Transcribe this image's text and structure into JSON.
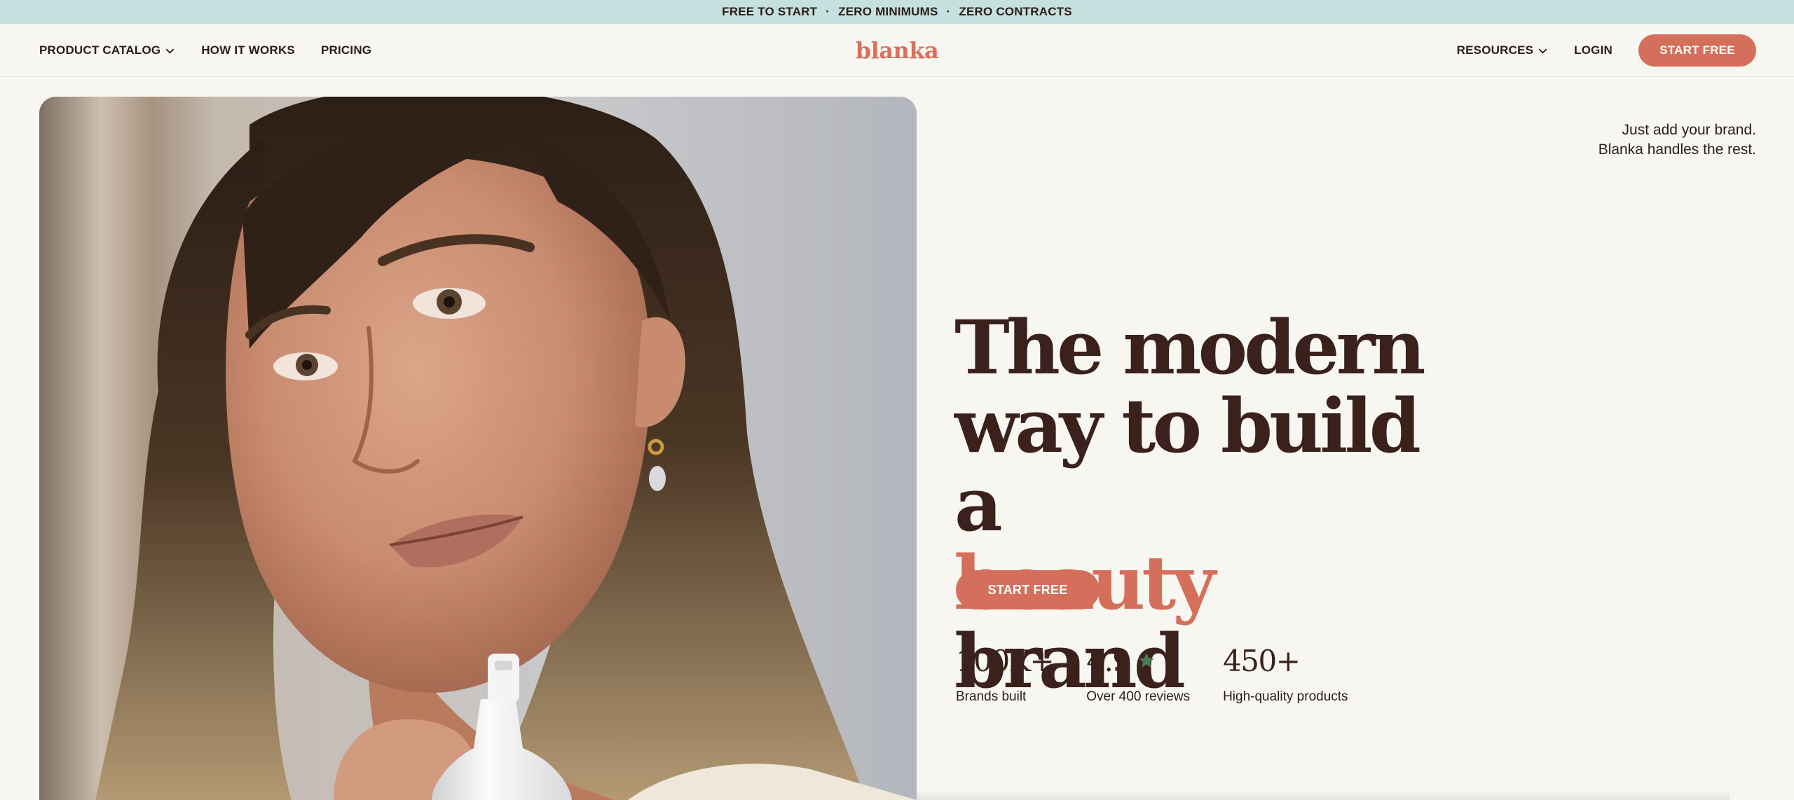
{
  "announcement": {
    "items": [
      "FREE TO START",
      "ZERO MINIMUMS",
      "ZERO CONTRACTS"
    ],
    "separator": "·"
  },
  "nav": {
    "left": [
      {
        "label": "PRODUCT CATALOG",
        "dropdown": true
      },
      {
        "label": "HOW IT WORKS"
      },
      {
        "label": "PRICING"
      }
    ],
    "logo": "blanka",
    "right": {
      "resources": "RESOURCES",
      "login": "LOGIN",
      "cta": "START FREE"
    }
  },
  "hero": {
    "tagline_line1": "Just add your brand.",
    "tagline_line2": "Blanka handles the rest.",
    "headline_line1": "The modern",
    "headline_line2": "way to build a",
    "headline_accent": "beauty",
    "headline_end": " brand",
    "cta": "START FREE",
    "image_subject": "woman-holding-pump-bottle"
  },
  "stats": [
    {
      "value": "100K+",
      "label": "Brands built"
    },
    {
      "value": "4.9",
      "label": "Over 400 reviews",
      "icon": "star-icon"
    },
    {
      "value": "450+",
      "label": "High-quality products"
    }
  ],
  "colors": {
    "announcement_bg": "#c5e0df",
    "page_bg": "#f8f6f1",
    "accent": "#d46f5b",
    "text_dark": "#3b211c",
    "star": "#4a7a56"
  }
}
